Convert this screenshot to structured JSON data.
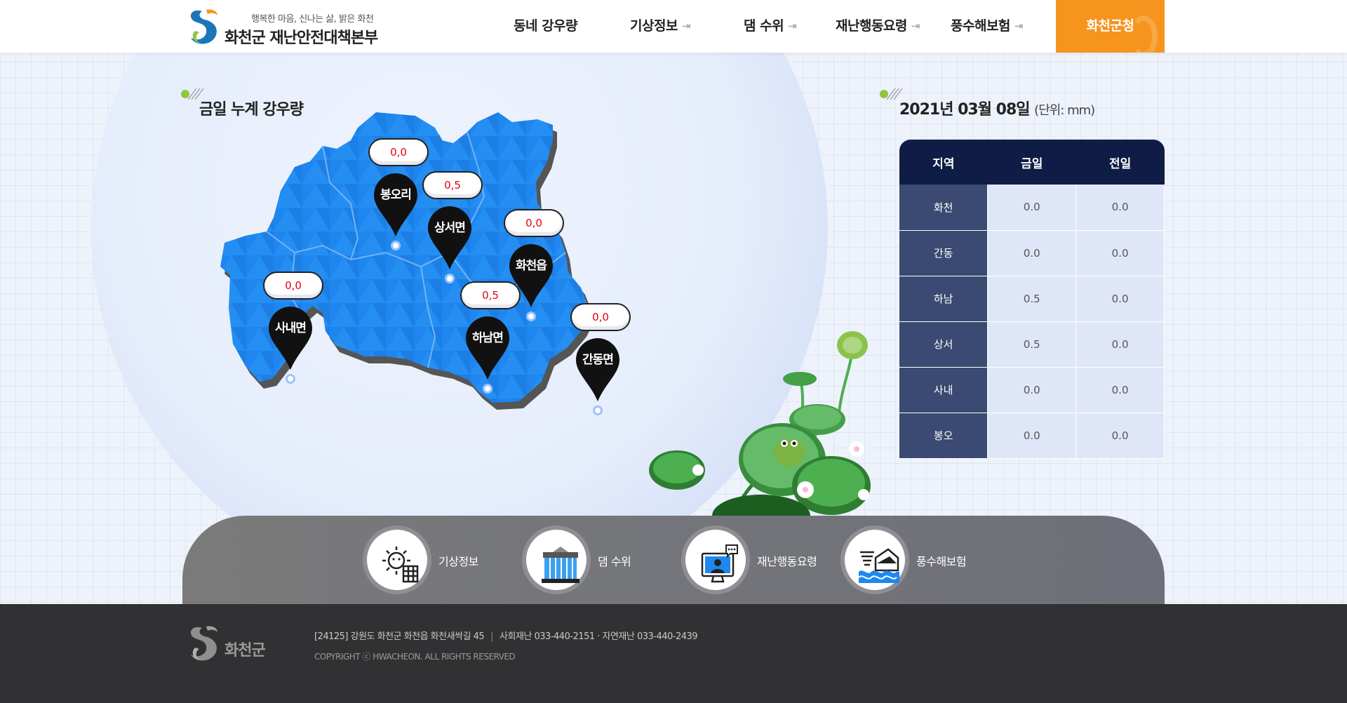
{
  "header": {
    "slogan": "행복한 마음, 신나는 삶, 밝은 화천",
    "title": "화천군 재난안전대책본부",
    "nav": [
      {
        "label": "동네 강우량",
        "external": false
      },
      {
        "label": "기상정보",
        "external": true
      },
      {
        "label": "댐 수위",
        "external": true
      },
      {
        "label": "재난행동요령",
        "external": true
      },
      {
        "label": "풍수해보험",
        "external": true
      }
    ],
    "cta": "화천군청"
  },
  "map_section": {
    "title": "금일 누계 강우량",
    "pins": [
      {
        "name": "봉오리",
        "value": "0,0"
      },
      {
        "name": "상서면",
        "value": "0,5"
      },
      {
        "name": "화천읍",
        "value": "0,0"
      },
      {
        "name": "사내면",
        "value": "0,0"
      },
      {
        "name": "하남면",
        "value": "0,5"
      },
      {
        "name": "간동면",
        "value": "0,0"
      }
    ]
  },
  "table_section": {
    "date": "2021년 03월 08일",
    "unit": "(단위: mm)",
    "headers": [
      "지역",
      "금일",
      "전일"
    ],
    "rows": [
      {
        "region": "화천",
        "today": "0.0",
        "yesterday": "0.0"
      },
      {
        "region": "간동",
        "today": "0.0",
        "yesterday": "0.0"
      },
      {
        "region": "하남",
        "today": "0.5",
        "yesterday": "0.0"
      },
      {
        "region": "상서",
        "today": "0.5",
        "yesterday": "0.0"
      },
      {
        "region": "사내",
        "today": "0.0",
        "yesterday": "0.0"
      },
      {
        "region": "봉오",
        "today": "0.0",
        "yesterday": "0.0"
      }
    ]
  },
  "shortcuts": [
    {
      "label": "기상정보",
      "icon": "weather-icon"
    },
    {
      "label": "댐 수위",
      "icon": "dam-icon"
    },
    {
      "label": "재난행동요령",
      "icon": "disaster-guide-icon"
    },
    {
      "label": "풍수해보험",
      "icon": "flood-insurance-icon"
    }
  ],
  "footer": {
    "logo_text": "화천군",
    "address": "[24125] 강원도 화천군 화천읍 화천새싹길 45",
    "phones": "사회재난 033-440-2151 · 자연재난 033-440-2439",
    "copyright": "COPYRIGHT ⓒ HWACHEON. ALL RIGHTS RESERVED"
  },
  "colors": {
    "accent": "#f7941d",
    "navy": "#0f1c45",
    "map_blue": "#1e88f0",
    "value_red": "#e60012"
  }
}
